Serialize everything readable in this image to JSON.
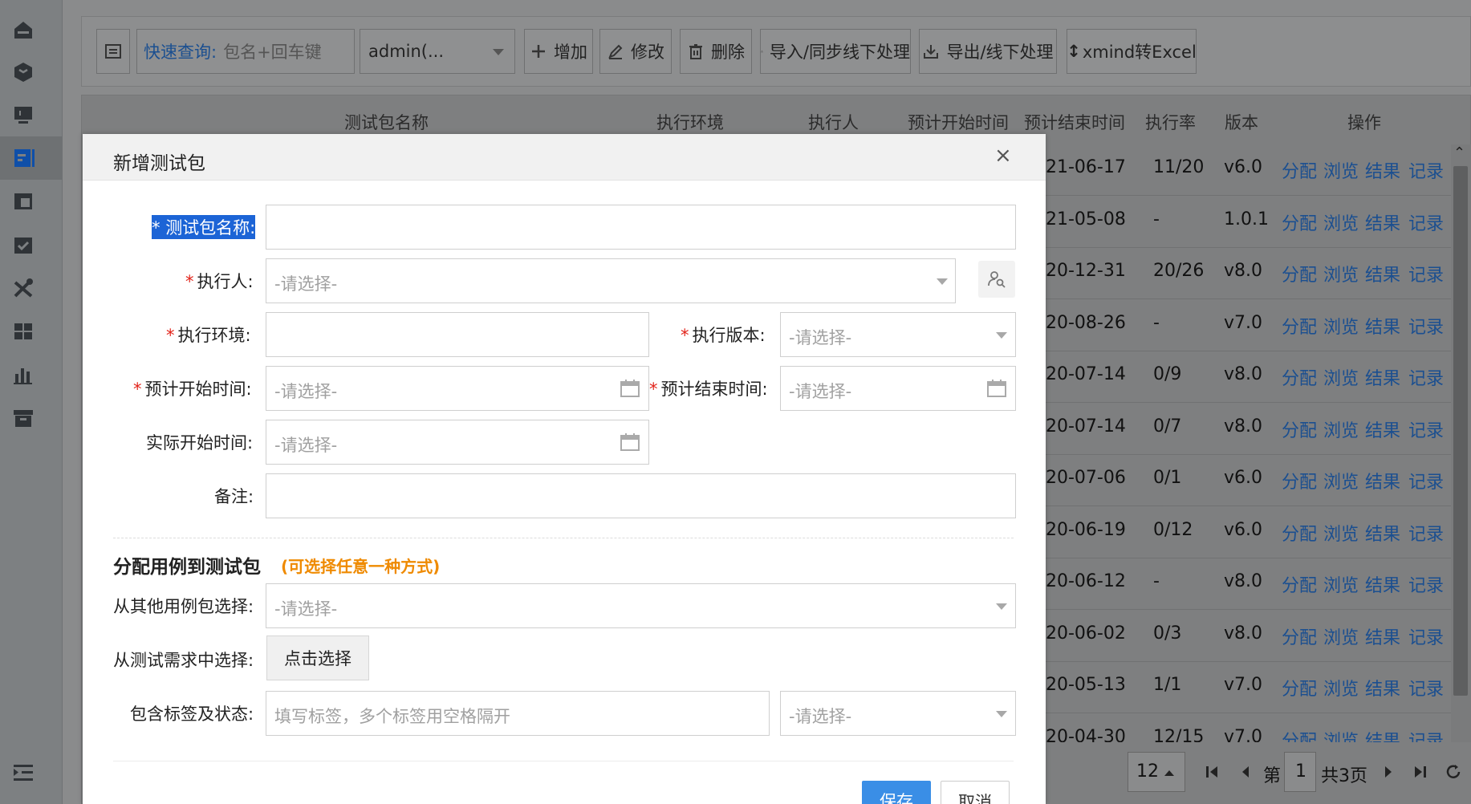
{
  "toolbar": {
    "quick_search_label": "快速查询:",
    "quick_search_placeholder": "包名+回车键",
    "user_select": "admin(...",
    "add": "增加",
    "edit": "修改",
    "delete": "删除",
    "import": "导入/同步线下处理",
    "export": "导出/线下处理",
    "xmind": "xmind转Excel"
  },
  "table": {
    "headers": [
      "测试包名称",
      "执行环境",
      "执行人",
      "预计开始时间",
      "预计结束时间",
      "执行率",
      "版本",
      "操作"
    ],
    "rows": [
      {
        "end": "21-06-17",
        "rate": "11/20",
        "version": "v6.0"
      },
      {
        "end": "21-05-08",
        "rate": "-",
        "version": "1.0.1"
      },
      {
        "end": "20-12-31",
        "rate": "20/26",
        "version": "v8.0"
      },
      {
        "end": "20-08-26",
        "rate": "-",
        "version": "v7.0"
      },
      {
        "end": "20-07-14",
        "rate": "0/9",
        "version": "v8.0"
      },
      {
        "end": "20-07-14",
        "rate": "0/7",
        "version": "v8.0"
      },
      {
        "end": "20-07-06",
        "rate": "0/1",
        "version": "v6.0"
      },
      {
        "end": "20-06-19",
        "rate": "0/12",
        "version": "v6.0"
      },
      {
        "end": "20-06-12",
        "rate": "-",
        "version": "v8.0"
      },
      {
        "end": "20-06-02",
        "rate": "0/3",
        "version": "v8.0"
      },
      {
        "end": "20-05-13",
        "rate": "1/1",
        "version": "v7.0"
      },
      {
        "end": "20-04-30",
        "rate": "12/15",
        "version": "v7.0"
      }
    ],
    "ops": [
      "分配",
      "浏览",
      "结果",
      "记录"
    ]
  },
  "pager": {
    "page_size": "12",
    "page_prefix": "第",
    "page_current": "1",
    "page_total": "共3页"
  },
  "modal": {
    "title": "新增测试包",
    "close": "×",
    "required_mark": "*",
    "labels": {
      "name": "测试包名称:",
      "executor": "执行人:",
      "env": "执行环境:",
      "version": "执行版本:",
      "plan_start": "预计开始时间:",
      "plan_end": "预计结束时间:",
      "actual_start": "实际开始时间:",
      "remark": "备注:",
      "from_pkg": "从其他用例包选择:",
      "from_req": "从测试需求中选择:",
      "tags": "包含标签及状态:"
    },
    "select_placeholder": "-请选择-",
    "tags_placeholder": "填写标签，多个标签用空格隔开",
    "section_title": "分配用例到测试包",
    "section_hint": "(可选择任意一种方式)",
    "pick_button": "点击选择",
    "save": "保存",
    "cancel": "取消"
  }
}
